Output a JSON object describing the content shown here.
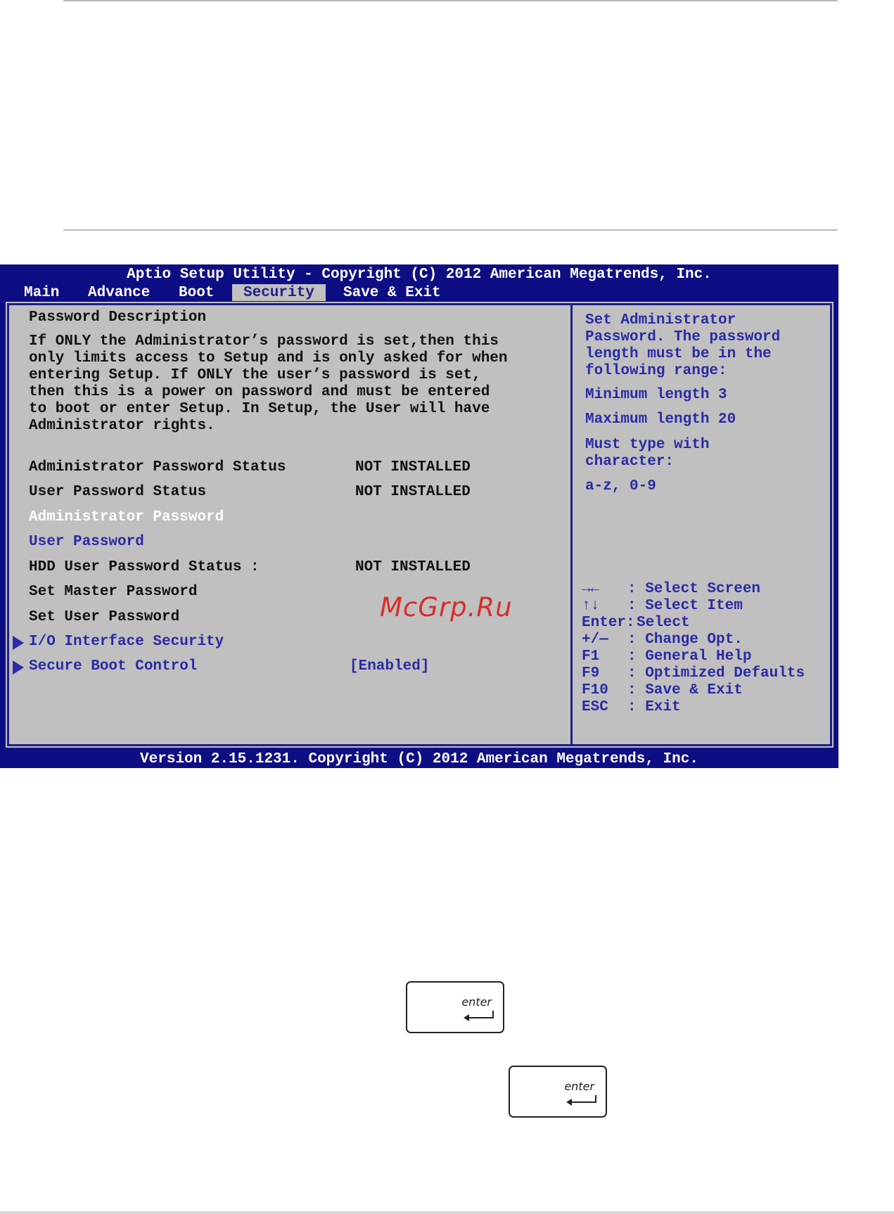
{
  "header": {
    "title": "Aptio Setup Utility - Copyright (C) 2012 American Megatrends, Inc."
  },
  "tabs": [
    {
      "label": "Main"
    },
    {
      "label": "Advance"
    },
    {
      "label": "Boot"
    },
    {
      "label": "Security",
      "active": true
    },
    {
      "label": "Save & Exit"
    }
  ],
  "main": {
    "description_title": "Password Description",
    "description_lines": [
      "If ONLY the Administrator’s password is set,then this",
      "only limits access to Setup and is only asked for when",
      "entering Setup. If ONLY the user’s password is set,",
      "then this is a power on password and must be entered",
      "to boot or enter Setup. In Setup, the User will have",
      "Administrator rights."
    ],
    "admin_status_label": "Administrator Password Status",
    "admin_status_value": "NOT INSTALLED",
    "user_status_label": "User Password Status",
    "user_status_value": "NOT INSTALLED",
    "admin_password": "Administrator Password",
    "user_password": "User Password",
    "hdd_status_label": "HDD User Password Status :",
    "hdd_status_value": "NOT INSTALLED",
    "set_master": "Set Master Password",
    "set_user": "Set User Password",
    "io_security": "I/O Interface Security",
    "secure_boot": "Secure Boot Control",
    "secure_boot_value": "[Enabled]"
  },
  "help": {
    "lines": [
      "Set Administrator",
      "Password. The password",
      "length must be in the",
      "following range:"
    ],
    "min_length": "Minimum length 3",
    "max_length": "Maximum length 20",
    "type_lines": [
      "Must type with",
      "character:"
    ],
    "chars": "a-z, 0-9"
  },
  "keys": [
    {
      "key": "→←",
      "action": ": Select Screen"
    },
    {
      "key": "↑↓",
      "action": ": Select Item"
    },
    {
      "key": "Enter:",
      "action": "Select"
    },
    {
      "key": "+/—",
      "action": ": Change Opt."
    },
    {
      "key": "F1",
      "action": ": General Help"
    },
    {
      "key": "F9",
      "action": ": Optimized Defaults"
    },
    {
      "key": "F10",
      "action": ": Save & Exit"
    },
    {
      "key": "ESC",
      "action": ": Exit"
    }
  ],
  "footer": {
    "version": "Version 2.15.1231. Copyright (C) 2012 American Megatrends, Inc."
  },
  "watermark": "McGrp.Ru",
  "enter_keys": [
    {
      "label": "enter"
    },
    {
      "label": "enter"
    }
  ],
  "colors": {
    "bios_blue": "#0e0e84",
    "panel_gray": "#c0c0c0",
    "item_blue": "#2a2aa6",
    "watermark_red": "#dd2020"
  }
}
